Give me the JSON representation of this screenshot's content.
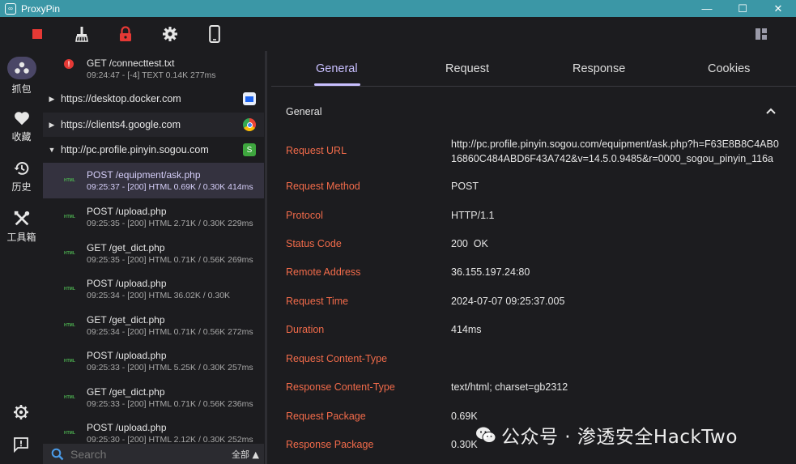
{
  "window": {
    "title": "ProxyPin",
    "minimize": "—",
    "maximize": "☐",
    "close": "✕"
  },
  "nav": [
    {
      "label": "抓包",
      "icon": "capture-icon"
    },
    {
      "label": "收藏",
      "icon": "heart-icon"
    },
    {
      "label": "历史",
      "icon": "history-icon"
    },
    {
      "label": "工具箱",
      "icon": "toolbox-icon"
    }
  ],
  "requests_top": {
    "title": "GET /connecttest.txt",
    "sub": "09:24:47 - [-4]  TEXT 0.14K 277ms"
  },
  "hosts": [
    {
      "name": "https://desktop.docker.com",
      "expanded": false
    },
    {
      "name": "https://clients4.google.com",
      "expanded": false
    },
    {
      "name": "http://pc.profile.pinyin.sogou.com",
      "expanded": true
    }
  ],
  "requests": [
    {
      "title": "POST /equipment/ask.php",
      "sub": "09:25:37 - [200]  HTML 0.69K / 0.30K  414ms",
      "icon": "HTML"
    },
    {
      "title": "POST /upload.php",
      "sub": "09:25:35 - [200]  HTML 2.71K / 0.30K  229ms",
      "icon": "HTML"
    },
    {
      "title": "GET /get_dict.php",
      "sub": "09:25:35 - [200]  HTML 0.71K / 0.56K  269ms",
      "icon": "HTML"
    },
    {
      "title": "POST /upload.php",
      "sub": "09:25:34 - [200]  HTML 36.02K / 0.30K",
      "icon": "HTML"
    },
    {
      "title": "GET /get_dict.php",
      "sub": "09:25:34 - [200]  HTML 0.71K / 0.56K  272ms",
      "icon": "HTML"
    },
    {
      "title": "POST /upload.php",
      "sub": "09:25:33 - [200]  HTML 5.25K / 0.30K  257ms",
      "icon": "HTML"
    },
    {
      "title": "GET /get_dict.php",
      "sub": "09:25:33 - [200]  HTML 0.71K / 0.56K  236ms",
      "icon": "HTML"
    },
    {
      "title": "POST /upload.php",
      "sub": "09:25:30 - [200]  HTML 2.12K / 0.30K  252ms",
      "icon": "HTML"
    }
  ],
  "search": {
    "placeholder": "Search",
    "filter": "全部 ▲"
  },
  "tabs": [
    "General",
    "Request",
    "Response",
    "Cookies"
  ],
  "section": {
    "title": "General"
  },
  "general": {
    "request_url_label": "Request URL",
    "request_url": "http://pc.profile.pinyin.sogou.com/equipment/ask.php?h=F63E8B8C4AB016860C484ABD6F43A742&v=14.5.0.9485&r=0000_sogou_pinyin_116a",
    "request_method_label": "Request Method",
    "request_method": "POST",
    "protocol_label": "Protocol",
    "protocol": "HTTP/1.1",
    "status_code_label": "Status Code",
    "status_code": "200  OK",
    "remote_address_label": "Remote Address",
    "remote_address": "36.155.197.24:80",
    "request_time_label": "Request Time",
    "request_time": "2024-07-07 09:25:37.005",
    "duration_label": "Duration",
    "duration": "414ms",
    "req_content_type_label": "Request Content-Type",
    "req_content_type": "",
    "resp_content_type_label": "Response Content-Type",
    "resp_content_type": "text/html; charset=gb2312",
    "request_package_label": "Request Package",
    "request_package": "0.69K",
    "response_package_label": "Response Package",
    "response_package": "0.30K"
  },
  "watermark": {
    "text": "公众号 · 渗透安全HackTwo"
  },
  "colors": {
    "accent": "#c8bfff",
    "label_red": "#f26b4a",
    "titlebar": "#3b97a6",
    "stop_red": "#e53935"
  }
}
